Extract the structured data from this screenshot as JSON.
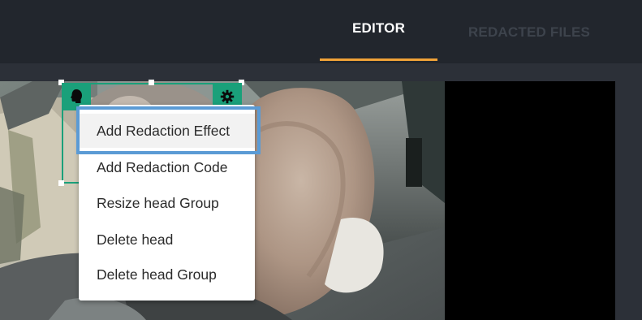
{
  "tabs": [
    {
      "label": "EDITOR",
      "active": true
    },
    {
      "label": "REDACTED FILES",
      "active": false
    }
  ],
  "colors": {
    "accent": "#f0a238",
    "bbox": "#1aa07a",
    "focus": "#5b9bd5"
  },
  "bbox": {
    "left_icon": "head-icon",
    "right_icon": "gear-icon"
  },
  "context_menu": {
    "items": [
      {
        "label": "Add Redaction Effect",
        "highlighted": true
      },
      {
        "label": "Add Redaction Code"
      },
      {
        "label": "Resize head Group"
      },
      {
        "label": "Delete head"
      },
      {
        "label": "Delete head Group"
      }
    ]
  }
}
